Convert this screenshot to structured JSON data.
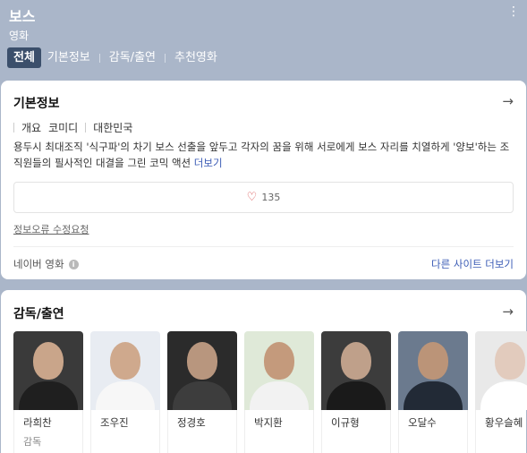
{
  "header": {
    "title": "보스",
    "subtitle": "영화",
    "tabs": [
      {
        "label": "전체"
      },
      {
        "label": "기본정보"
      },
      {
        "label": "감독/출연"
      },
      {
        "label": "추천영화"
      }
    ]
  },
  "basic_info": {
    "title": "기본정보",
    "category": "개요",
    "genre": "코미디",
    "country": "대한민국",
    "synopsis": "용두시 최대조직 '식구파'의 차기 보스 선출을 앞두고 각자의 꿈을 위해 서로에게 보스 자리를 치열하게 '양보'하는 조직원들의 필사적인 대결을 그린 코믹 액션",
    "more_label": "더보기",
    "likes": "135",
    "report_label": "정보오류 수정요청",
    "source_label": "네이버 영화",
    "other_sites_label": "다른 사이트 더보기"
  },
  "cast": {
    "title": "감독/출연",
    "people": [
      {
        "name": "라희찬",
        "role": "감독",
        "bg": "#3a3a3a",
        "skin": "#c9a58a",
        "cloth": "#1f1f1f"
      },
      {
        "name": "조우진",
        "role": "",
        "bg": "#e8ecf2",
        "skin": "#cfa98d",
        "cloth": "#f7f7f7"
      },
      {
        "name": "정경호",
        "role": "",
        "bg": "#2b2b2b",
        "skin": "#b8967e",
        "cloth": "#3d3d3d"
      },
      {
        "name": "박지환",
        "role": "",
        "bg": "#dfe9d8",
        "skin": "#c49a7c",
        "cloth": "#f2f2f2"
      },
      {
        "name": "이규형",
        "role": "",
        "bg": "#3c3c3c",
        "skin": "#bfa08a",
        "cloth": "#1a1a1a"
      },
      {
        "name": "오달수",
        "role": "",
        "bg": "#6b7a8e",
        "skin": "#bb9478",
        "cloth": "#222a36"
      },
      {
        "name": "황우슬혜",
        "role": "",
        "bg": "#e9e9e9",
        "skin": "#e2cbbd",
        "cloth": "#ffffff"
      }
    ]
  }
}
